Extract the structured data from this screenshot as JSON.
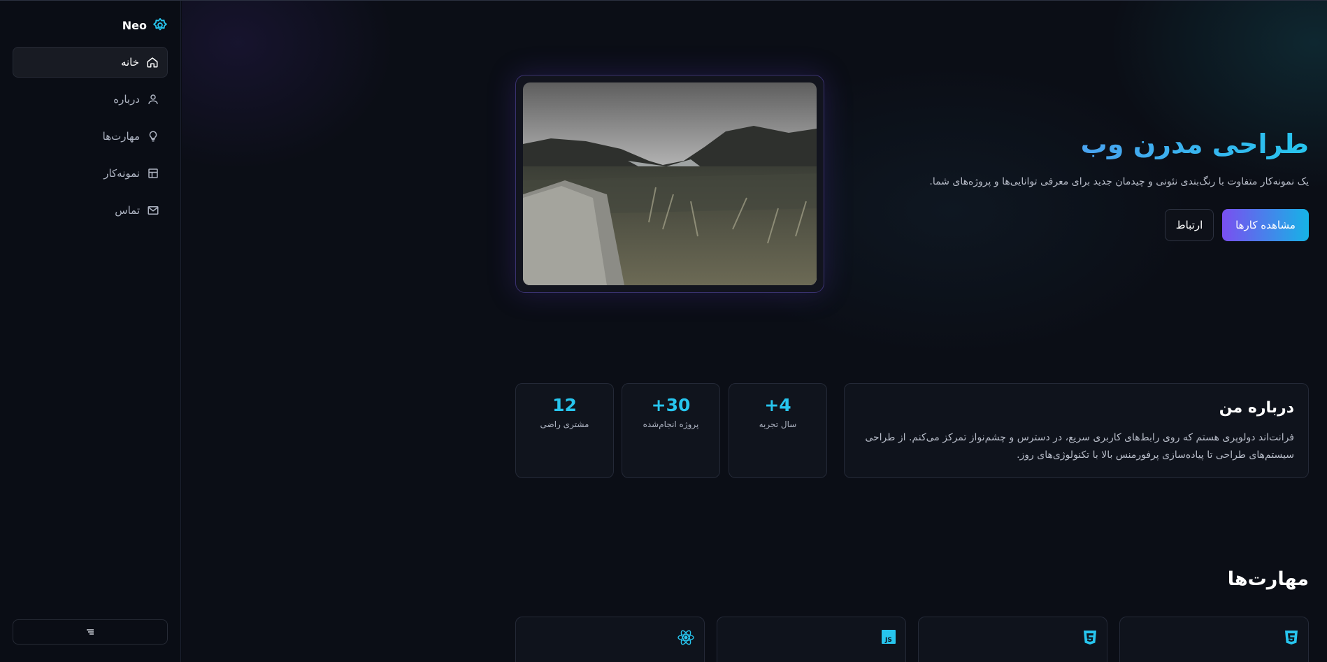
{
  "brand": {
    "name": "Neo",
    "icon": "gear-icon",
    "accent": "#27c5ee"
  },
  "sidebar": {
    "items": [
      {
        "label": "خانه",
        "icon": "home-icon",
        "active": true
      },
      {
        "label": "درباره",
        "icon": "user-icon",
        "active": false
      },
      {
        "label": "مهارت‌ها",
        "icon": "lightbulb-icon",
        "active": false
      },
      {
        "label": "نمونه‌کار",
        "icon": "layout-icon",
        "active": false
      },
      {
        "label": "تماس",
        "icon": "mail-icon",
        "active": false
      }
    ],
    "collapse_icon": "menu-lines-icon"
  },
  "hero": {
    "title": "طراحی مدرن وب",
    "subtitle": "یک نمونه‌کار متفاوت با رنگ‌بندی نئونی و چیدمان جدید برای معرفی توانایی‌ها و پروژه‌های شما.",
    "primary_button": "مشاهده کارها",
    "secondary_button": "ارتباط",
    "image": "landscape-photo-icon"
  },
  "about": {
    "title": "درباره من",
    "body": "فرانت‌اند دولوپری هستم که روی رابط‌های کاربری سریع، در دسترس و چشم‌نواز تمرکز می‌کنم. از طراحی سیستم‌های طراحی تا پیاده‌سازی پرفورمنس بالا با تکنولوژی‌های روز."
  },
  "stats": [
    {
      "value": "+4",
      "label": "سال تجربه"
    },
    {
      "value": "+30",
      "label": "پروژه انجام‌شده"
    },
    {
      "value": "12",
      "label": "مشتری راضی"
    }
  ],
  "skills": {
    "title": "مهارت‌ها",
    "cards": [
      {
        "icon": "html5-icon"
      },
      {
        "icon": "css3-icon"
      },
      {
        "icon": "javascript-icon"
      },
      {
        "icon": "react-icon"
      }
    ]
  },
  "colors": {
    "accent": "#27c5ee",
    "gradient_start": "#7a4ff0",
    "gradient_end": "#16b3e6",
    "background": "#0b0e16"
  }
}
